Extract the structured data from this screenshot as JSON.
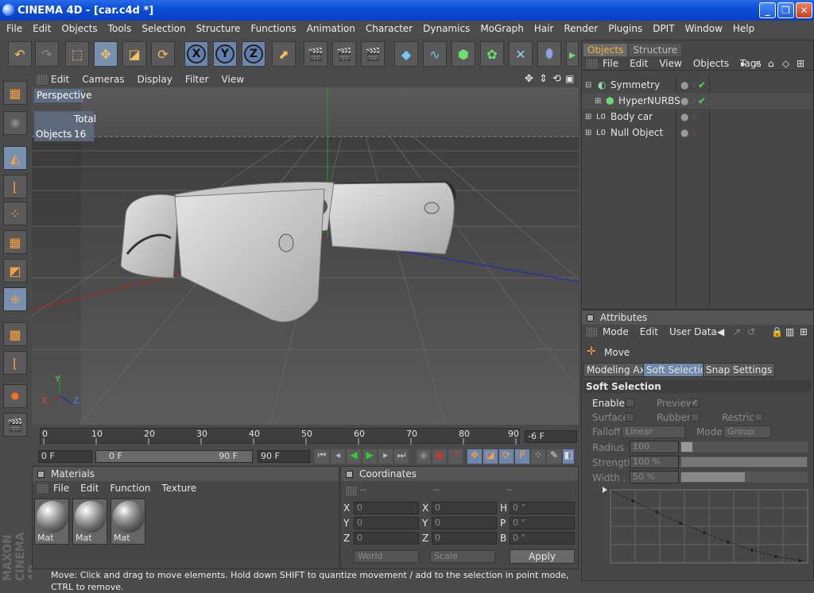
{
  "window": {
    "title": "CINEMA 4D - [car.c4d *]",
    "min": "_",
    "restore": "❐",
    "close": "✕"
  },
  "menubar": [
    "File",
    "Edit",
    "Objects",
    "Tools",
    "Selection",
    "Structure",
    "Functions",
    "Animation",
    "Character",
    "Dynamics",
    "MoGraph",
    "Hair",
    "Render",
    "Plugins",
    "DPIT",
    "Window",
    "Help"
  ],
  "toolbar": {
    "axis_x": "X",
    "axis_y": "Y",
    "axis_z": "Z"
  },
  "viewport": {
    "menu": [
      "Edit",
      "Cameras",
      "Display",
      "Filter",
      "View"
    ],
    "camera_label": "Perspective",
    "info_header": "Total",
    "info_label": "Objects",
    "info_value": "16",
    "axis_x": "X",
    "axis_y": "Y",
    "axis_z": "Z"
  },
  "timeline": {
    "ticks": [
      "0",
      "10",
      "20",
      "30",
      "40",
      "50",
      "60",
      "70",
      "80",
      "90"
    ],
    "current": "-6 F"
  },
  "playbar": {
    "start": "0 F",
    "range_start": "0 F",
    "range_end": "90 F",
    "end": "90 F"
  },
  "materials": {
    "title": "Materials",
    "menu": [
      "File",
      "Edit",
      "Function",
      "Texture"
    ],
    "items": [
      "Mat",
      "Mat",
      "Mat"
    ]
  },
  "coordinates": {
    "title": "Coordinates",
    "col_headers": [
      "--",
      "--",
      "--"
    ],
    "rows": [
      {
        "a": "X",
        "av": "0",
        "b": "X",
        "bv": "0",
        "c": "H",
        "cv": "0 °"
      },
      {
        "a": "Y",
        "av": "0",
        "b": "Y",
        "bv": "0",
        "c": "P",
        "cv": "0 °"
      },
      {
        "a": "Z",
        "av": "0",
        "b": "Z",
        "bv": "0",
        "c": "B",
        "cv": "0 °"
      }
    ],
    "mode1": "World",
    "mode2": "Scale",
    "apply": "Apply"
  },
  "objects": {
    "tabs": [
      "Objects",
      "Structure"
    ],
    "menu": [
      "File",
      "Edit",
      "View",
      "Objects",
      "Tags"
    ],
    "items": [
      {
        "label": "Symmetry",
        "check": "✔"
      },
      {
        "label": "HyperNURBS",
        "check": "✔"
      },
      {
        "label": "Body car",
        "check": ""
      },
      {
        "label": "Null Object",
        "check": ""
      }
    ]
  },
  "attributes": {
    "title": "Attributes",
    "menu": [
      "Mode",
      "Edit",
      "User Data"
    ],
    "tool": "Move",
    "tabs": [
      "Modeling Axis",
      "Soft Selection",
      "Snap Settings"
    ],
    "section": "Soft Selection",
    "enable": "Enable",
    "preview": "Preview",
    "surface": "Surface",
    "rubber": "Rubber",
    "restrict": "Restrict",
    "falloff": "Falloff",
    "falloff_value": "Linear",
    "mode": "Mode",
    "mode_value": "Group",
    "radius": "Radius",
    "radius_value": "100",
    "strength": "Strength",
    "strength_value": "100 %",
    "width": "Width . .",
    "width_value": "50 %"
  },
  "statusbar": "Move: Click and drag to move elements. Hold down SHIFT to quantize movement / add to the selection in point mode, CTRL to remove.",
  "branding": {
    "line1": "MAXON",
    "line2": "CINEMA 4D"
  }
}
